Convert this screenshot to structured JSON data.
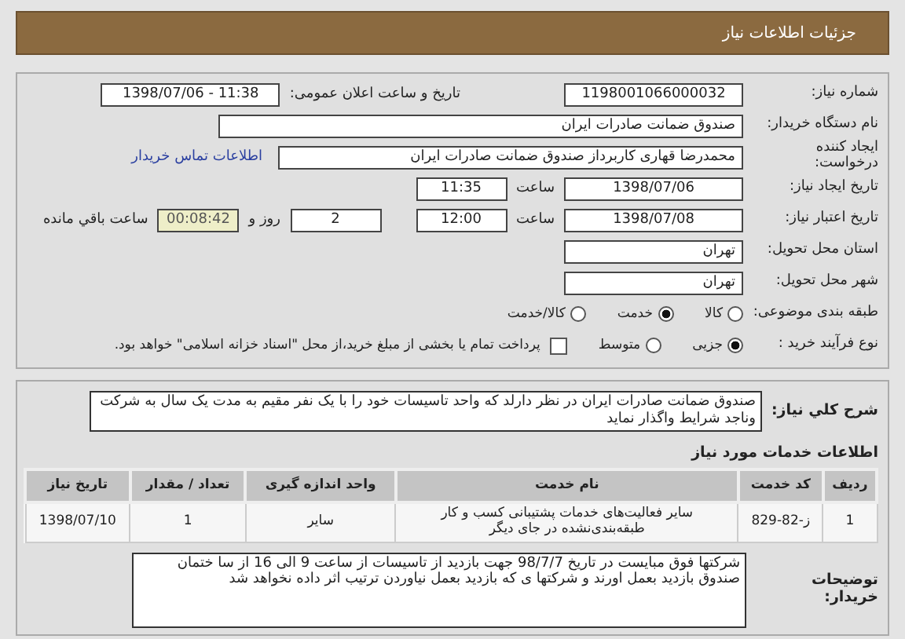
{
  "header": {
    "title": "جزئیات اطلاعات نیاز"
  },
  "need_number": {
    "label": "شماره نیاز:",
    "value": "1198001066000032"
  },
  "announce": {
    "label": "تاریخ و ساعت اعلان عمومی:",
    "value": "1398/07/06 - 11:38"
  },
  "buyer_org": {
    "label": "نام دستگاه خریدار:",
    "value": "صندوق ضمانت صادرات ایران"
  },
  "creator": {
    "label": "ایجاد کننده درخواست:",
    "value": "محمدرضا قهاری کاربرداز صندوق ضمانت صادرات ایران",
    "link": "اطلاعات تماس خریدار"
  },
  "created": {
    "label": "تاریخ ایجاد نیاز:",
    "date": "1398/07/06",
    "time_label": "ساعت",
    "time": "11:35"
  },
  "validity": {
    "label": "تاریخ اعتبار نیاز:",
    "date": "1398/07/08",
    "time_label": "ساعت",
    "time": "12:00",
    "days": "2",
    "days_label": "روز و",
    "remaining": "00:08:42",
    "remaining_label": "ساعت باقي مانده"
  },
  "province": {
    "label": "استان محل تحویل:",
    "value": "تهران"
  },
  "city": {
    "label": "شهر محل تحویل:",
    "value": "تهران"
  },
  "category": {
    "label": "طبقه بندی موضوعی:",
    "options": [
      {
        "label": "کالا",
        "selected": false
      },
      {
        "label": "خدمت",
        "selected": true
      },
      {
        "label": "کالا/خدمت",
        "selected": false
      }
    ]
  },
  "process": {
    "label": "نوع فرآیند خرید :",
    "options": [
      {
        "label": "جزیی",
        "selected": true
      },
      {
        "label": "متوسط",
        "selected": false
      }
    ],
    "payment": {
      "checked": false,
      "label": "پرداخت تمام یا بخشی از مبلغ خرید،از محل \"اسناد خزانه اسلامی\" خواهد بود."
    }
  },
  "description": {
    "label": "شرح کلي نياز:",
    "text": "صندوق ضمانت صادرات ایران در نظر دارلد که واحد  تاسیسات خود را با یک نفر مقیم به مدت یک سال به شرکت وناجد شرایط واگذار نماید"
  },
  "services": {
    "title": "اطلاعات خدمات مورد نیاز",
    "columns": [
      "ردیف",
      "کد خدمت",
      "نام خدمت",
      "واحد اندازه گیری",
      "تعداد / مقدار",
      "تاریخ نیاز"
    ],
    "rows": [
      [
        "1",
        "ز-82-829",
        "سایر فعالیت‌های خدمات پشتیبانی کسب و کار طبقه‌بندی‌نشده در جای دیگر",
        "سایر",
        "1",
        "1398/07/10"
      ]
    ]
  },
  "buyer_notes": {
    "label": "توضیحات خریدار:",
    "text": "شرکتها فوق مبایست در تاریخ 98/7/7 جهت بازدید از تاسیسات از ساعت 9 الی 16 از سا ختمان صندوق بازدید بعمل اورند و شرکتها ی که بازدید بعمل نیاوردن ترتیب اثر داده نخواهد شد"
  }
}
